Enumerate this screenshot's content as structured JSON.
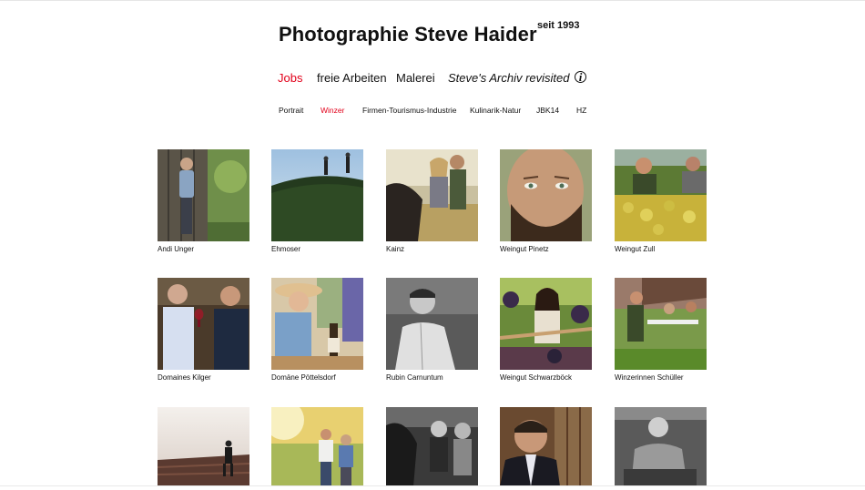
{
  "header": {
    "title": "Photographie Steve Haider",
    "since": "seit 1993"
  },
  "main_nav": [
    {
      "label": "Jobs",
      "active": true
    },
    {
      "label": "freie Arbeiten",
      "active": false
    },
    {
      "label": "Malerei",
      "active": false
    },
    {
      "label": "Steve's Archiv revisited",
      "active": false
    },
    {
      "label": "i",
      "icon": "info-icon"
    }
  ],
  "sub_nav": [
    {
      "label": "Portrait",
      "active": false
    },
    {
      "label": "Winzer",
      "active": true
    },
    {
      "label": "Firmen-Tourismus-Industrie",
      "active": false
    },
    {
      "label": "Kulinarik-Natur",
      "active": false
    },
    {
      "label": "JBK14",
      "active": false
    },
    {
      "label": "HZ",
      "active": false
    }
  ],
  "gallery": [
    {
      "caption": "Andi Unger"
    },
    {
      "caption": "Ehmoser"
    },
    {
      "caption": "Kainz"
    },
    {
      "caption": "Weingut Pinetz"
    },
    {
      "caption": "Weingut Zull"
    },
    {
      "caption": "Domaines Kilger"
    },
    {
      "caption": "Domäne Pöttelsdorf"
    },
    {
      "caption": "Rubin Carnuntum"
    },
    {
      "caption": "Weingut Schwarzböck"
    },
    {
      "caption": "Winzerinnen Schüller"
    },
    {
      "caption": ""
    },
    {
      "caption": ""
    },
    {
      "caption": ""
    },
    {
      "caption": ""
    },
    {
      "caption": ""
    }
  ],
  "colors": {
    "accent": "#e2001a",
    "text": "#111111",
    "background": "#ffffff"
  }
}
